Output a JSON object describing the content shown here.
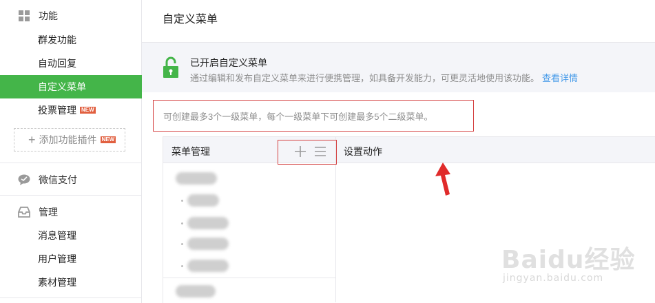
{
  "sidebar": {
    "section_function": "功能",
    "items": [
      {
        "label": "群发功能"
      },
      {
        "label": "自动回复"
      },
      {
        "label": "自定义菜单"
      },
      {
        "label": "投票管理"
      }
    ],
    "new_badge": "NEW",
    "add_plugin_label": "添加功能插件",
    "pay_label": "微信支付",
    "section_manage": "管理",
    "manage_items": [
      {
        "label": "消息管理"
      },
      {
        "label": "用户管理"
      },
      {
        "label": "素材管理"
      }
    ]
  },
  "main": {
    "title": "自定义菜单",
    "notice": {
      "title": "已开启自定义菜单",
      "desc": "通过编辑和发布自定义菜单来进行便携管理，如具备开发能力，可更灵活地使用该功能。",
      "link": "查看详情"
    },
    "limit_tip": "可创建最多3个一级菜单，每个一级菜单下可创建最多5个二级菜单。",
    "editor": {
      "menu_header": "菜单管理",
      "action_header": "设置动作"
    }
  },
  "watermark": {
    "brand": "Baidu经验",
    "url": "jingyan.baidu.com"
  },
  "colors": {
    "accent_green": "#44b549",
    "highlight_red": "#d44040",
    "link_blue": "#459ae9"
  }
}
